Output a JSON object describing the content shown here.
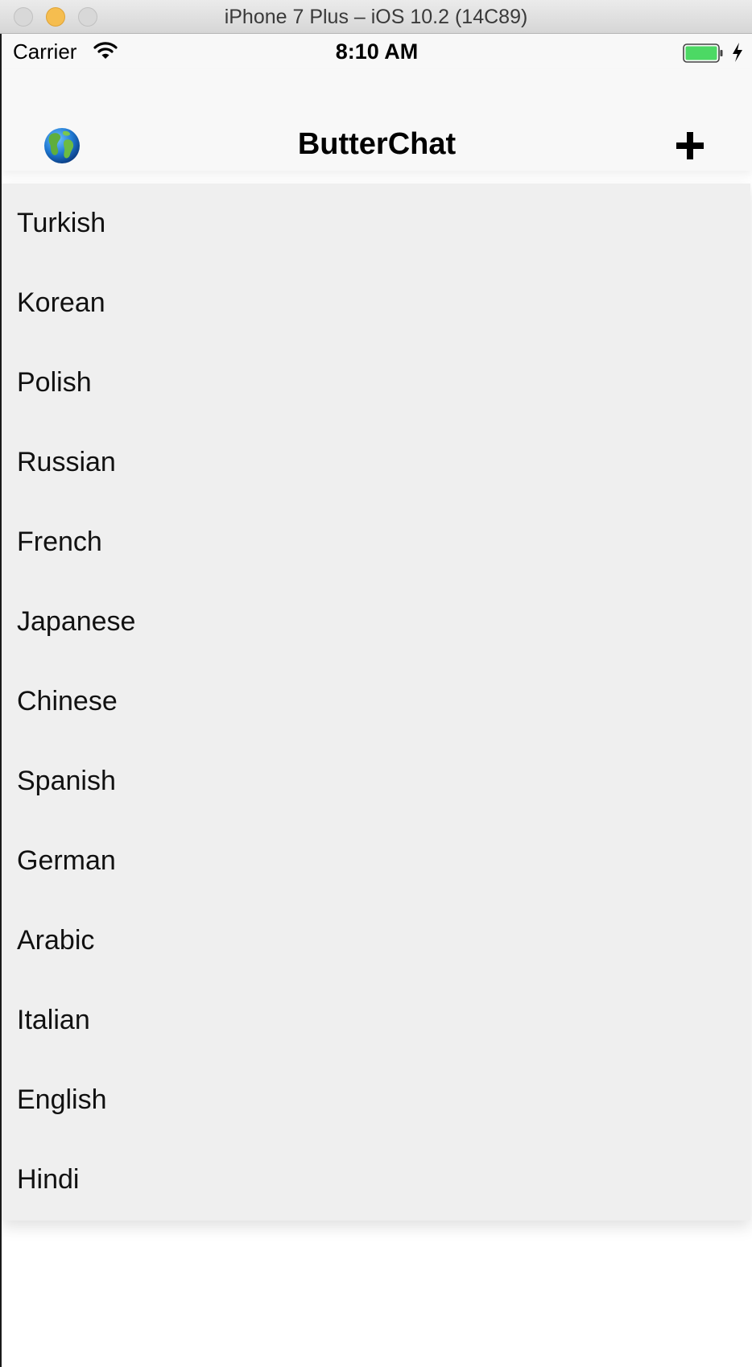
{
  "window": {
    "title": "iPhone 7 Plus – iOS 10.2 (14C89)"
  },
  "status_bar": {
    "carrier": "Carrier",
    "time": "8:10 AM",
    "battery_color": "#4cd964"
  },
  "nav_bar": {
    "title": "ButterChat",
    "left_icon": "globe-icon",
    "right_icon": "plus-icon"
  },
  "language_menu": {
    "items": [
      "Turkish",
      "Korean",
      "Polish",
      "Russian",
      "French",
      "Japanese",
      "Chinese",
      "Spanish",
      "German",
      "Arabic",
      "Italian",
      "English",
      "Hindi"
    ]
  }
}
